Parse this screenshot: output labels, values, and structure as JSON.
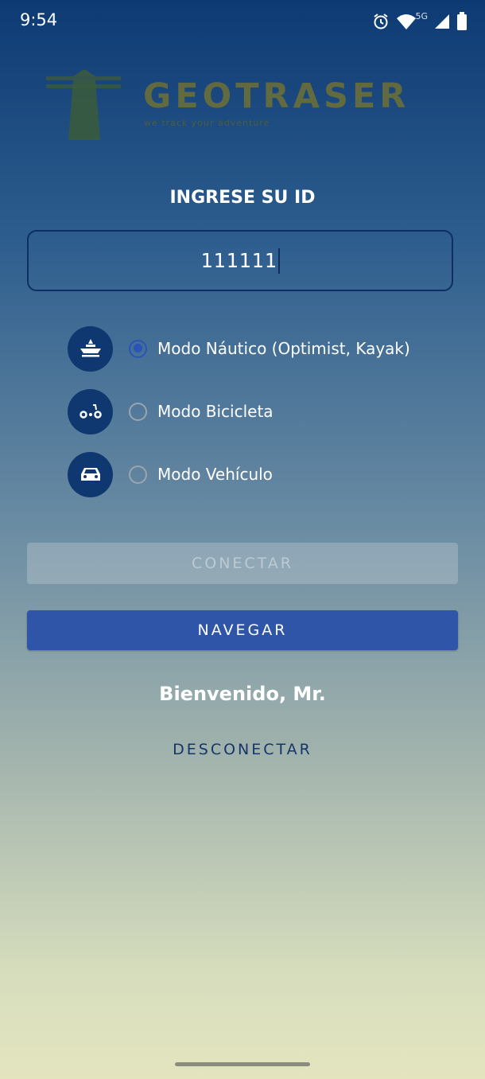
{
  "status_bar": {
    "time": "9:54",
    "network_label": "5G",
    "icons": [
      "alarm-icon",
      "wifi-icon",
      "signal-icon",
      "battery-icon"
    ]
  },
  "logo": {
    "word": "GEOTRASER",
    "tagline": "we track your adventure"
  },
  "form": {
    "heading": "INGRESE SU ID",
    "id_value": "111111"
  },
  "modes": [
    {
      "label": "Modo Náutico (Optimist, Kayak)",
      "icon": "boat-icon",
      "selected": true
    },
    {
      "label": "Modo Bicicleta",
      "icon": "bicycle-icon",
      "selected": false
    },
    {
      "label": "Modo Vehículo",
      "icon": "car-icon",
      "selected": false
    }
  ],
  "buttons": {
    "connect": "CONECTAR",
    "navigate": "NAVEGAR",
    "disconnect": "DESCONECTAR"
  },
  "welcome_text": "Bienvenido, Mr.",
  "colors": {
    "accent": "#2f55a8",
    "icon_circle": "#0f3770",
    "radio_selected": "#2a54b5"
  }
}
